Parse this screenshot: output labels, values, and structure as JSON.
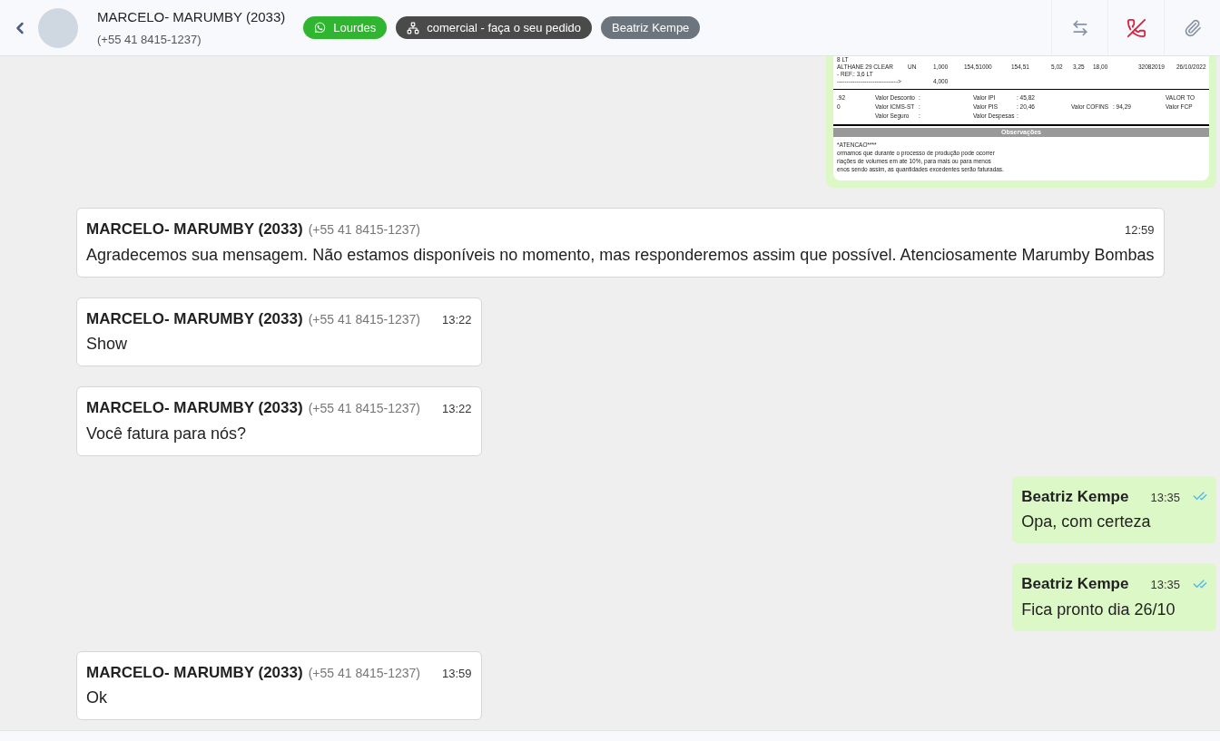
{
  "header": {
    "contact_name": "MARCELO- MARUMBY (2033)",
    "contact_phone": "(+55 41 8415-1237)",
    "tags": [
      {
        "kind": "channel",
        "label": "Lourdes",
        "color": "#2fb52f"
      },
      {
        "kind": "queue",
        "label": "comercial - faça o seu pedido",
        "color": "#4a4a4a"
      },
      {
        "kind": "user",
        "label": "Beatriz Kempe",
        "color": "#6c757d"
      }
    ]
  },
  "messages": [
    {
      "kind": "document",
      "outgoing": true,
      "document": {
        "item_lines": [
          {
            "description": "8 LT"
          },
          {
            "description": "ALTHANE 29 CLEAR",
            "unit": "UN",
            "quantity": "1,000",
            "unit_price": "154,51000",
            "total": "154,51",
            "column_6": "5,02",
            "column_7": "3,25",
            "column_8": "18,00",
            "column_9": "32082019",
            "column_10": "26/10/2022"
          },
          {
            "description": "- REF.: 3,6 LT"
          },
          {
            "description": "------------------------------->",
            "quantity": "4,000"
          }
        ],
        "total_lines": [
          {
            "code": ".92",
            "label_1": "Valor Desconto",
            "value_1": ":",
            "label_2": "Valor IPI",
            "value_2": ":  45,82",
            "label_4": "VALOR TO"
          },
          {
            "code": "0",
            "label_1": "Valor ICMS-ST",
            "value_1": ":",
            "label_2": "Valor PIS",
            "value_2": ":  20,46",
            "label_3": "Valor COFINS",
            "value_3": ":  94,29",
            "label_4": "Valor FCP"
          },
          {
            "label_1": "Valor Seguro",
            "value_1": ":",
            "label_2": "Valor Despesas",
            "value_2": ":"
          }
        ],
        "notes_title": "Observações",
        "notes": [
          "*ATENCAO****",
          "ormamos que durante o processo de produção pode ocorrer",
          "riações de volumes em ate 10%, para mais ou para menos",
          "enos sendo assim, as quantidades excedentes serão faturadas."
        ]
      }
    },
    {
      "kind": "text",
      "outgoing": false,
      "sender": "MARCELO- MARUMBY (2033)",
      "phone": "(+55 41 8415-1237)",
      "time": "12:59",
      "text": "Agradecemos sua mensagem. Não estamos disponíveis no momento, mas responderemos assim que possível. Atenciosamente Marumby Bombas"
    },
    {
      "kind": "text",
      "outgoing": false,
      "sender": "MARCELO- MARUMBY (2033)",
      "phone": "(+55 41 8415-1237)",
      "time": "13:22",
      "text": "Show"
    },
    {
      "kind": "text",
      "outgoing": false,
      "sender": "MARCELO- MARUMBY (2033)",
      "phone": "(+55 41 8415-1237)",
      "time": "13:22",
      "text": "Você fatura para nós?"
    },
    {
      "kind": "text",
      "outgoing": true,
      "sender": "Beatriz Kempe",
      "time": "13:35",
      "text": "Opa, com certeza",
      "read": true
    },
    {
      "kind": "text",
      "outgoing": true,
      "sender": "Beatriz Kempe",
      "time": "13:35",
      "text": "Fica pronto dia 26/10",
      "read": true
    },
    {
      "kind": "text",
      "outgoing": false,
      "sender": "MARCELO- MARUMBY (2033)",
      "phone": "(+55 41 8415-1237)",
      "time": "13:59",
      "text": "Ok"
    }
  ]
}
